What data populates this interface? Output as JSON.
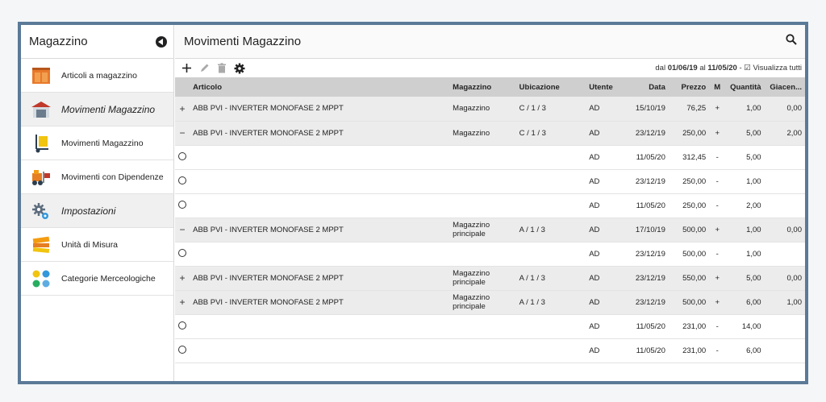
{
  "sidebar": {
    "title": "Magazzino",
    "items": [
      {
        "label": "Articoli a magazzino",
        "icon": "warehouse-doors-icon",
        "section": false
      },
      {
        "label": "Movimenti Magazzino",
        "icon": "warehouse-building-icon",
        "section": true
      },
      {
        "label": "Movimenti Magazzino",
        "icon": "hand-truck-icon",
        "section": false
      },
      {
        "label": "Movimenti con Dipendenze",
        "icon": "forklift-icon",
        "section": false
      },
      {
        "label": "Impostazioni",
        "icon": "gear-settings-icon",
        "section": true
      },
      {
        "label": "Unità di Misura",
        "icon": "tape-measure-icon",
        "section": false
      },
      {
        "label": "Categorie Merceologiche",
        "icon": "categories-dots-icon",
        "section": false
      }
    ]
  },
  "main": {
    "title": "Movimenti Magazzino",
    "range": {
      "prefix": "dal",
      "from": "01/06/19",
      "mid": "al",
      "to": "11/05/20",
      "toggle": "- ☑ Visualizza tutti"
    },
    "columns": {
      "articolo": "Articolo",
      "magazzino": "Magazzino",
      "ubicazione": "Ubicazione",
      "utente": "Utente",
      "data": "Data",
      "prezzo": "Prezzo",
      "m": "M",
      "quantita": "Quantità",
      "giacenza": "Giacen..."
    },
    "rows": [
      {
        "type": "parent",
        "mark": "+",
        "articolo": "ABB PVI - INVERTER MONOFASE 2 MPPT",
        "magazzino": "Magazzino",
        "ubicazione": "C / 1 / 3",
        "utente": "AD",
        "data": "15/10/19",
        "prezzo": "76,25",
        "m": "+",
        "quantita": "1,00",
        "giacenza": "0,00"
      },
      {
        "type": "parent",
        "mark": "−",
        "articolo": "ABB PVI - INVERTER MONOFASE 2 MPPT",
        "magazzino": "Magazzino",
        "ubicazione": "C / 1 / 3",
        "utente": "AD",
        "data": "23/12/19",
        "prezzo": "250,00",
        "m": "+",
        "quantita": "5,00",
        "giacenza": "2,00"
      },
      {
        "type": "child",
        "mark": "o",
        "articolo": "",
        "magazzino": "",
        "ubicazione": "",
        "utente": "AD",
        "data": "11/05/20",
        "prezzo": "312,45",
        "m": "-",
        "quantita": "5,00",
        "giacenza": ""
      },
      {
        "type": "child",
        "mark": "o",
        "articolo": "",
        "magazzino": "",
        "ubicazione": "",
        "utente": "AD",
        "data": "23/12/19",
        "prezzo": "250,00",
        "m": "-",
        "quantita": "1,00",
        "giacenza": ""
      },
      {
        "type": "child",
        "mark": "o",
        "articolo": "",
        "magazzino": "",
        "ubicazione": "",
        "utente": "AD",
        "data": "11/05/20",
        "prezzo": "250,00",
        "m": "-",
        "quantita": "2,00",
        "giacenza": ""
      },
      {
        "type": "parent",
        "mark": "−",
        "articolo": "ABB PVI - INVERTER MONOFASE 2 MPPT",
        "magazzino": "Magazzino principale",
        "ubicazione": "A / 1 / 3",
        "utente": "AD",
        "data": "17/10/19",
        "prezzo": "500,00",
        "m": "+",
        "quantita": "1,00",
        "giacenza": "0,00"
      },
      {
        "type": "child",
        "mark": "o",
        "articolo": "",
        "magazzino": "",
        "ubicazione": "",
        "utente": "AD",
        "data": "23/12/19",
        "prezzo": "500,00",
        "m": "-",
        "quantita": "1,00",
        "giacenza": ""
      },
      {
        "type": "parent",
        "mark": "+",
        "articolo": "ABB PVI - INVERTER MONOFASE 2 MPPT",
        "magazzino": "Magazzino principale",
        "ubicazione": "A / 1 / 3",
        "utente": "AD",
        "data": "23/12/19",
        "prezzo": "550,00",
        "m": "+",
        "quantita": "5,00",
        "giacenza": "0,00"
      },
      {
        "type": "parent",
        "mark": "+",
        "articolo": "ABB PVI - INVERTER MONOFASE 2 MPPT",
        "magazzino": "Magazzino principale",
        "ubicazione": "A / 1 / 3",
        "utente": "AD",
        "data": "23/12/19",
        "prezzo": "500,00",
        "m": "+",
        "quantita": "6,00",
        "giacenza": "1,00"
      },
      {
        "type": "child",
        "mark": "o",
        "articolo": "",
        "magazzino": "",
        "ubicazione": "",
        "utente": "AD",
        "data": "11/05/20",
        "prezzo": "231,00",
        "m": "-",
        "quantita": "14,00",
        "giacenza": ""
      },
      {
        "type": "child",
        "mark": "o",
        "articolo": "",
        "magazzino": "",
        "ubicazione": "",
        "utente": "AD",
        "data": "11/05/20",
        "prezzo": "231,00",
        "m": "-",
        "quantita": "6,00",
        "giacenza": ""
      }
    ]
  },
  "icons": {
    "search": "search-icon",
    "add": "plus-icon",
    "edit": "pencil-icon",
    "delete": "trash-icon",
    "settings": "gear-icon"
  }
}
